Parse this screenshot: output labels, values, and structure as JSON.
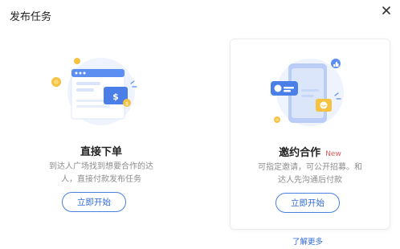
{
  "dialog": {
    "title": "发布任务",
    "close_icon": "close-icon"
  },
  "cards": [
    {
      "title": "直接下单",
      "description_line1": "到达人广场找到想要合作的达",
      "description_line2": "人，直接付款发布任务",
      "button_label": "立即开始",
      "illustration": "webpage-payment-illustration"
    },
    {
      "title": "邀约合作",
      "badge": "New",
      "description_line1": "可指定邀请，可公开招募。和",
      "description_line2": "达人先沟通后付款",
      "button_label": "立即开始",
      "illustration": "phone-chat-illustration"
    }
  ],
  "footer": {
    "learn_more": "了解更多"
  },
  "colors": {
    "accent": "#2f6ad9",
    "badge": "#e15a5a",
    "illustration_blue": "#5b8ef0",
    "coin_yellow": "#f5c242"
  }
}
